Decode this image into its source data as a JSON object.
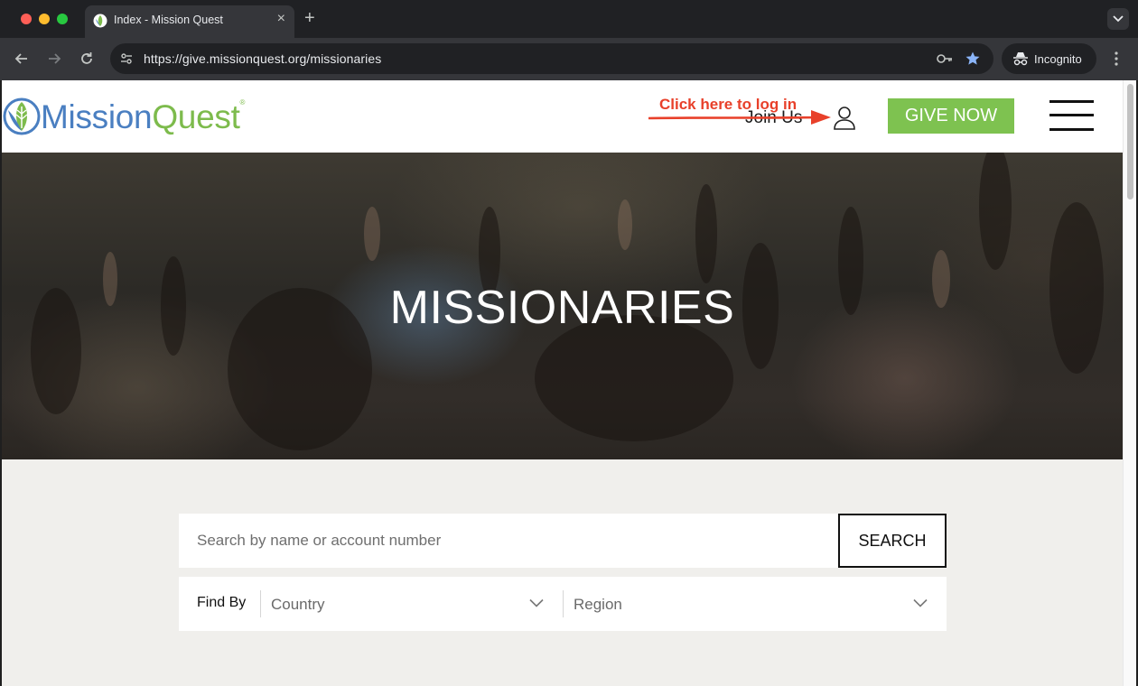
{
  "browser": {
    "tab_title": "Index - Mission Quest",
    "url_prefix": "https://give.",
    "url_domain": "missionquest.org",
    "url_path": "/missionaries",
    "profile_label": "Incognito",
    "accent_star_color": "#8ab4f8"
  },
  "header": {
    "logo_part1": "Mission",
    "logo_part2": "Quest",
    "logo_reg": "®",
    "join_us": "Join Us",
    "give_now": "GIVE NOW",
    "annotation": "Click here to log in",
    "brand_blue": "#4a7fc1",
    "brand_green": "#7dbb4c"
  },
  "hero": {
    "title": "MISSIONARIES"
  },
  "search": {
    "placeholder": "Search by name or account number",
    "value": "",
    "button_label": "SEARCH"
  },
  "filters": {
    "find_by_label": "Find By",
    "country_label": "Country",
    "region_label": "Region"
  }
}
